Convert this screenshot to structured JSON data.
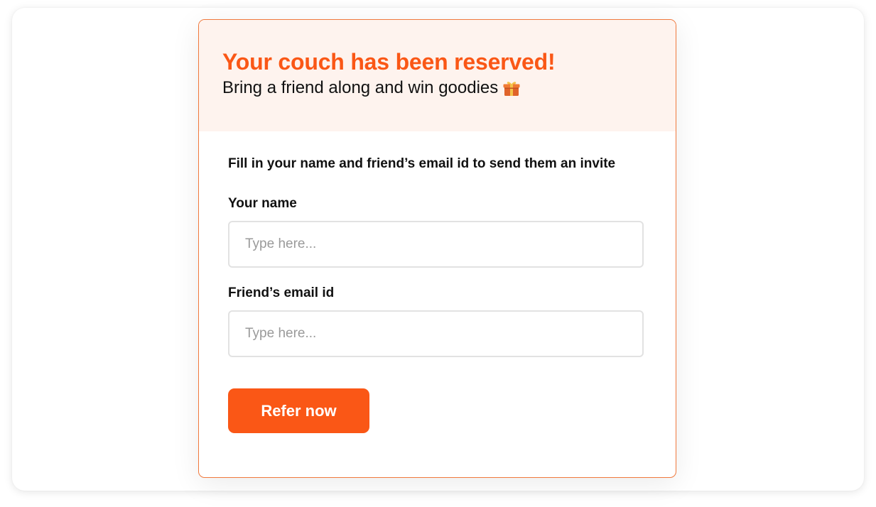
{
  "header": {
    "title": "Your couch has been reserved!",
    "subtitle": "Bring a friend along and win goodies",
    "subtitle_icon": "gift-icon"
  },
  "form": {
    "instruction": "Fill in your name and friend’s email id to send them an invite",
    "name_label": "Your name",
    "name_placeholder": "Type here...",
    "name_value": "",
    "email_label": "Friend’s email id",
    "email_placeholder": "Type here...",
    "email_value": "",
    "submit_label": "Refer now"
  },
  "colors": {
    "accent": "#fa5716",
    "header_background": "#fef3ee",
    "card_border": "#f0793d",
    "input_border": "#e2e2e2"
  }
}
